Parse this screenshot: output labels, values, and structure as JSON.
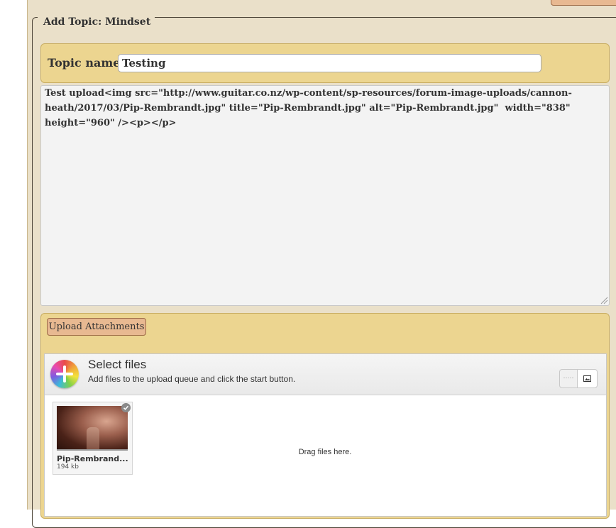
{
  "form": {
    "legend": "Add Topic: Mindset",
    "topic_name_label": "Topic name:",
    "topic_name_value": "Testing",
    "content_value": "Test upload<img src=\"http://www.guitar.co.nz/wp-content/sp-resources/forum-image-uploads/cannon-heath/2017/03/Pip-Rembrandt.jpg\" title=\"Pip-Rembrandt.jpg\" alt=\"Pip-Rembrandt.jpg\"  width=\"838\" height=\"960\" /><p></p>"
  },
  "attachments": {
    "upload_button_label": "Upload Attachments",
    "select_title": "Select files",
    "select_subtitle": "Add files to the upload queue and click the start button.",
    "list_view_glyph": "·····",
    "drag_text": "Drag files here.",
    "files": [
      {
        "name": "Pip-Rembrand...",
        "size": "194 kb"
      }
    ]
  },
  "colors": {
    "page_bg": "#eae0c9",
    "panel_bg": "#ecd590",
    "button_bg": "#e8b991",
    "textarea_bg": "#f3f3f3"
  },
  "icons": [
    "add-files-icon",
    "list-view-icon",
    "thumbnail-view-icon",
    "upload-complete-icon",
    "resize-grip-icon"
  ]
}
